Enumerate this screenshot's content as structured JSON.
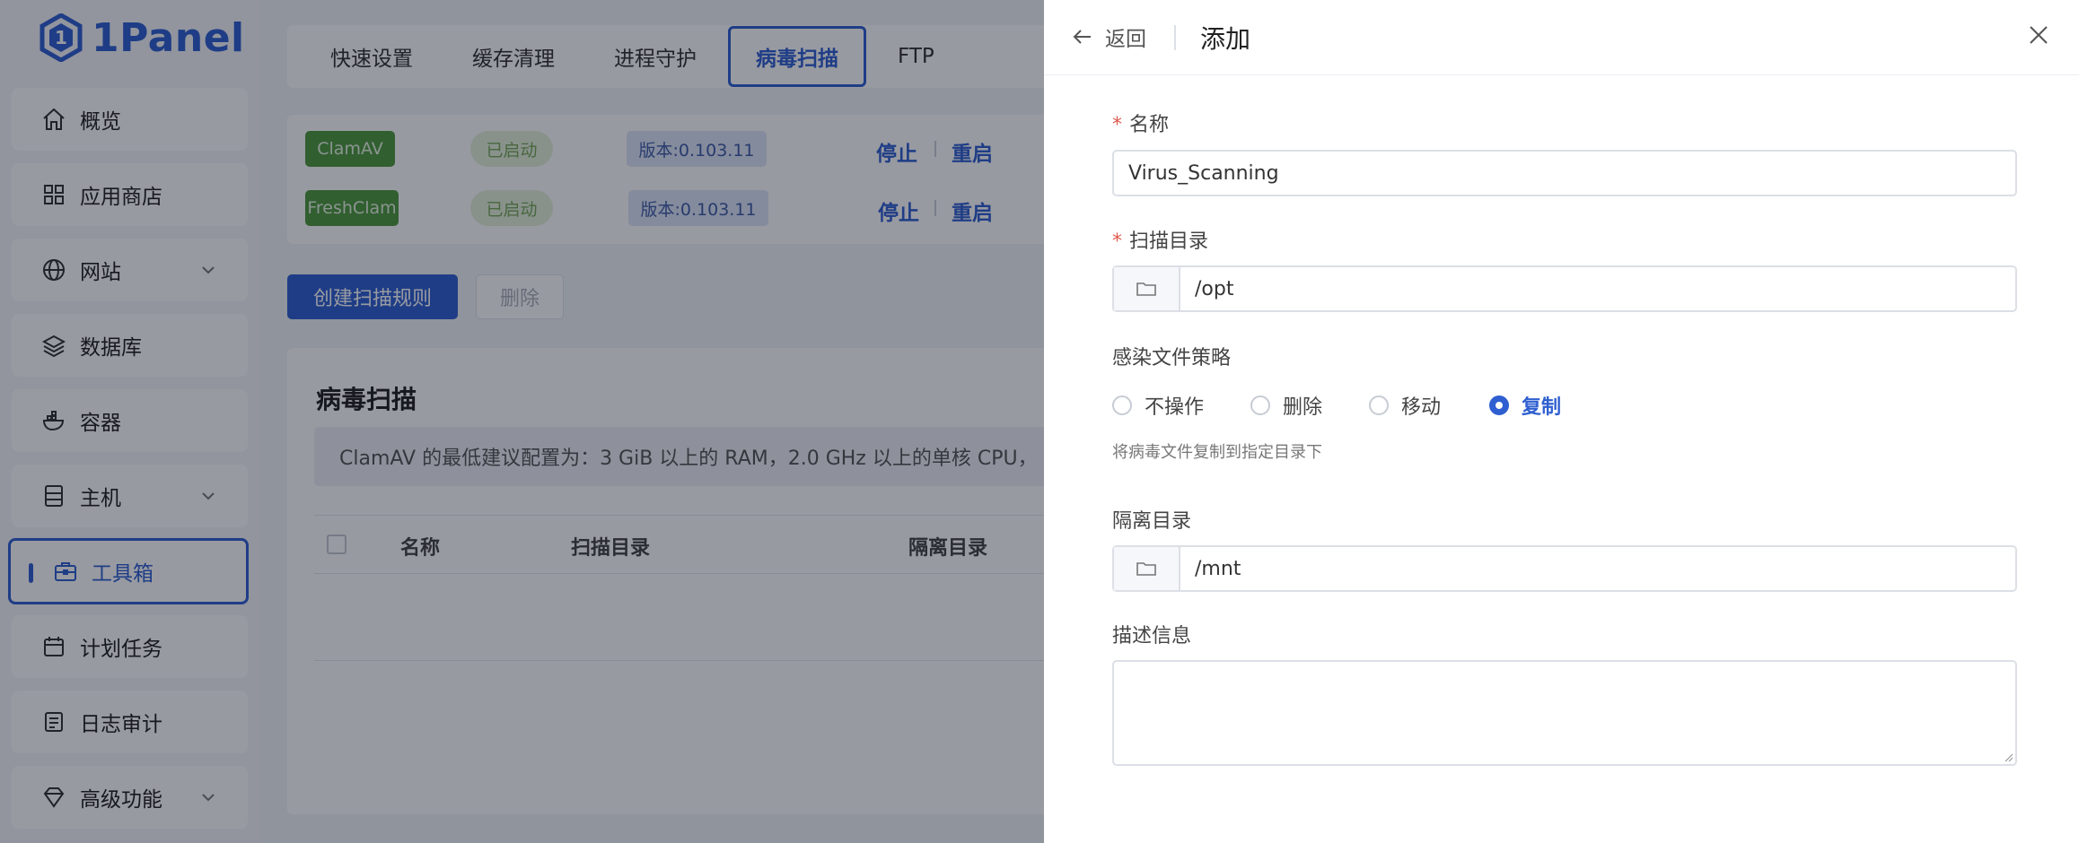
{
  "app": {
    "logo_text": "1Panel"
  },
  "sidebar": {
    "items": [
      {
        "label": "概览",
        "icon": "home-icon"
      },
      {
        "label": "应用商店",
        "icon": "grid-icon"
      },
      {
        "label": "网站",
        "icon": "globe-icon",
        "expandable": true
      },
      {
        "label": "数据库",
        "icon": "layers-icon"
      },
      {
        "label": "容器",
        "icon": "docker-icon"
      },
      {
        "label": "主机",
        "icon": "server-icon",
        "expandable": true
      },
      {
        "label": "工具箱",
        "icon": "toolbox-icon",
        "active": true
      },
      {
        "label": "计划任务",
        "icon": "calendar-icon"
      },
      {
        "label": "日志审计",
        "icon": "log-icon"
      },
      {
        "label": "高级功能",
        "icon": "diamond-icon",
        "expandable": true
      }
    ]
  },
  "tabs": [
    {
      "label": "快速设置"
    },
    {
      "label": "缓存清理"
    },
    {
      "label": "进程守护"
    },
    {
      "label": "病毒扫描",
      "active": true
    },
    {
      "label": "FTP"
    }
  ],
  "services": [
    {
      "name": "ClamAV",
      "status": "已启动",
      "version": "版本:0.103.11",
      "stop": "停止",
      "restart": "重启"
    },
    {
      "name": "FreshClam",
      "status": "已启动",
      "version": "版本:0.103.11",
      "stop": "停止",
      "restart": "重启"
    }
  ],
  "toolbar": {
    "create_label": "创建扫描规则",
    "delete_label": "删除"
  },
  "card": {
    "title": "病毒扫描",
    "notice": "ClamAV 的最低建议配置为：3 GiB 以上的 RAM，2.0 GHz 以上的单核 CPU，",
    "columns": [
      "名称",
      "扫描目录",
      "隔离目录"
    ]
  },
  "drawer": {
    "back_label": "返回",
    "title": "添加",
    "fields": {
      "name": {
        "label": "名称",
        "value": "Virus_Scanning"
      },
      "scan_dir": {
        "label": "扫描目录",
        "value": "/opt"
      },
      "policy": {
        "label": "感染文件策略",
        "options": [
          "不操作",
          "删除",
          "移动",
          "复制"
        ],
        "selected": "复制",
        "hint": "将病毒文件复制到指定目录下"
      },
      "quarantine_dir": {
        "label": "隔离目录",
        "value": "/mnt"
      },
      "description": {
        "label": "描述信息",
        "value": ""
      }
    }
  },
  "colors": {
    "primary": "#2f5fd0",
    "required": "#e05a4f",
    "running": "#4f9a3d"
  }
}
